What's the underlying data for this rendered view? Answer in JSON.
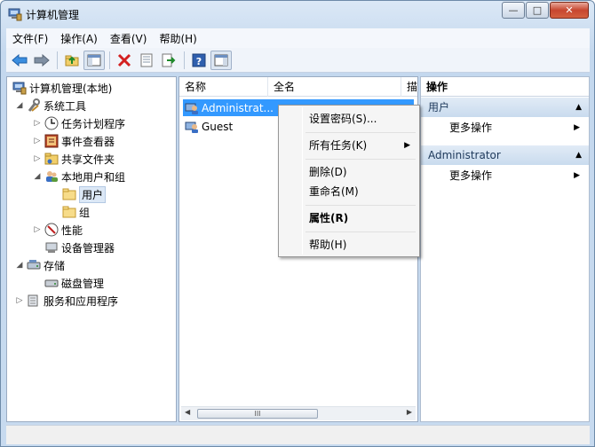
{
  "window": {
    "title": "计算机管理",
    "controls": {
      "minimize": "—",
      "maximize": "□",
      "close": "✕"
    }
  },
  "menubar": {
    "items": [
      "文件(F)",
      "操作(A)",
      "查看(V)",
      "帮助(H)"
    ]
  },
  "toolbar": {
    "buttons": [
      "back-arrow-icon",
      "forward-arrow-icon",
      "up-folder-icon",
      "show-hide-tree-icon",
      "delete-icon",
      "properties-icon",
      "export-icon",
      "help-icon",
      "action-pane-icon"
    ]
  },
  "tree": {
    "root": "计算机管理(本地)",
    "system_tools": "系统工具",
    "task_scheduler": "任务计划程序",
    "event_viewer": "事件查看器",
    "shared_folders": "共享文件夹",
    "local_users_groups": "本地用户和组",
    "users": "用户",
    "groups": "组",
    "performance": "性能",
    "device_manager": "设备管理器",
    "storage": "存储",
    "disk_management": "磁盘管理",
    "services_apps": "服务和应用程序"
  },
  "list": {
    "columns": [
      "名称",
      "全名",
      "描"
    ],
    "rows": [
      {
        "name": "Administrat...",
        "selected": true
      },
      {
        "name": "Guest",
        "selected": false
      }
    ],
    "scroll_thumb": "III"
  },
  "context_menu": {
    "set_password": "设置密码(S)...",
    "all_tasks": "所有任务(K)",
    "delete": "删除(D)",
    "rename": "重命名(M)",
    "properties": "属性(R)",
    "help": "帮助(H)"
  },
  "actions": {
    "title": "操作",
    "section1": "用户",
    "more1": "更多操作",
    "section2": "Administrator",
    "more2": "更多操作"
  },
  "colors": {
    "selection": "#3399ff",
    "section_header": "#c9dbee"
  }
}
